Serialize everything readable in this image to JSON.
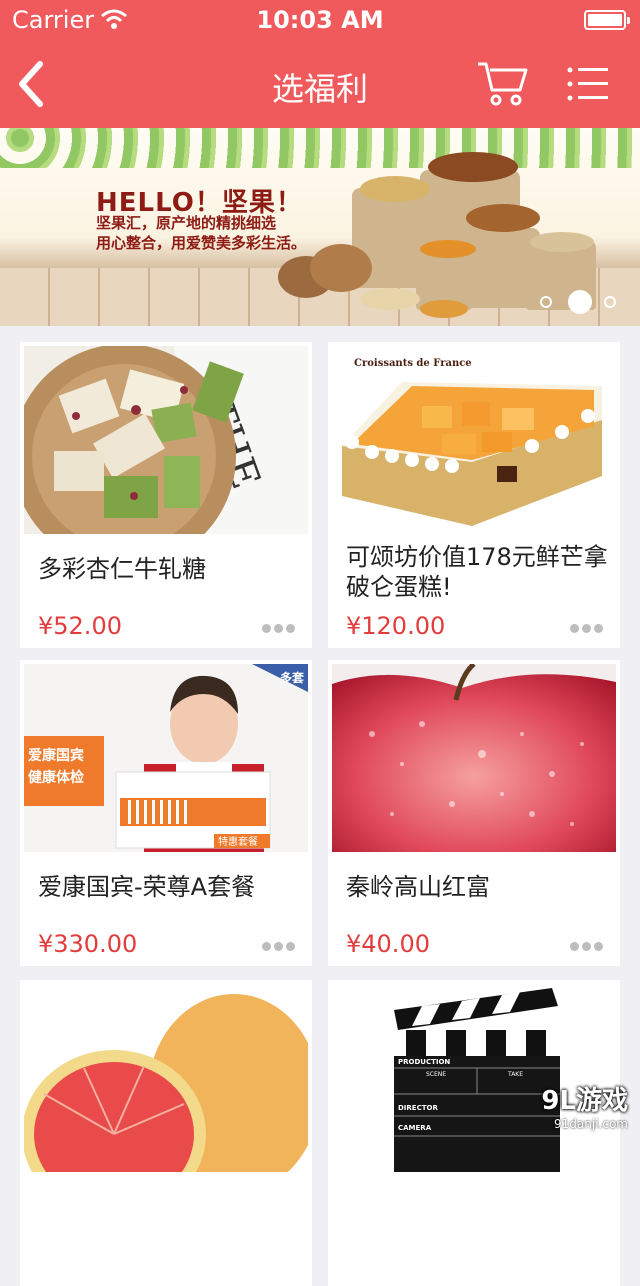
{
  "status_bar": {
    "carrier": "Carrier",
    "time": "10:03 AM"
  },
  "header": {
    "title": "选福利"
  },
  "banner": {
    "headline": "HELLO！坚果！",
    "line1": "坚果汇，原产地的精挑细选",
    "line2": "用心整合，用爱赞美多彩生活。",
    "slide_count": 3,
    "active_slide": 2
  },
  "products": [
    {
      "name": "多彩杏仁牛轧糖",
      "price": "¥52.00"
    },
    {
      "name": "可颂坊价值178元鲜芒拿破仑蛋糕!",
      "price": "¥120.00",
      "image_text": "Croissants de France"
    },
    {
      "name": "爱康国宾-荣尊A套餐",
      "price": "¥330.00",
      "image_text": [
        "爱康国宾",
        "健康体检",
        "特惠套餐",
        "多套"
      ]
    },
    {
      "name": "秦岭高山红富",
      "price": "¥40.00"
    },
    {
      "name": "",
      "price": ""
    },
    {
      "name": "",
      "price": "",
      "image_text": [
        "PRODUCTION",
        "SCENE",
        "TAKE",
        "DIRECTOR",
        "CAMERA"
      ]
    }
  ],
  "watermark": {
    "logo": "9L游戏",
    "site": "91danji.com"
  },
  "colors": {
    "brand": "#f05a5c",
    "price": "#e23c3c",
    "background": "#efeff4"
  }
}
